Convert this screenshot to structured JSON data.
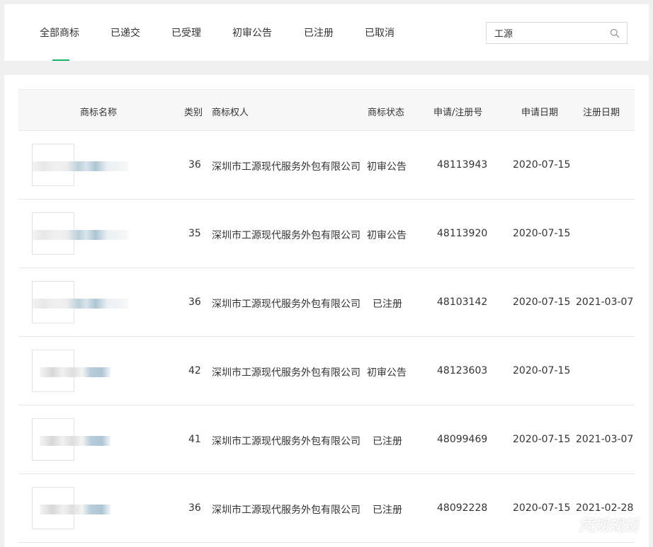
{
  "tabs": [
    {
      "label": "全部商标",
      "active": true
    },
    {
      "label": "已递交",
      "active": false
    },
    {
      "label": "已受理",
      "active": false
    },
    {
      "label": "初审公告",
      "active": false
    },
    {
      "label": "已注册",
      "active": false
    },
    {
      "label": "已取消",
      "active": false
    }
  ],
  "search": {
    "value": "工源",
    "icon": "search-icon"
  },
  "colors": {
    "accent": "#17b26a"
  },
  "table": {
    "headers": {
      "name": "商标名称",
      "category": "类别",
      "owner": "商标权人",
      "status": "商标状态",
      "number": "申请/注册号",
      "apply_date": "申请日期",
      "reg_date": "注册日期"
    },
    "rows": [
      {
        "category": "36",
        "owner": "深圳市工源现代服务外包有限公司",
        "status": "初审公告",
        "number": "48113943",
        "apply_date": "2020-07-15",
        "reg_date": ""
      },
      {
        "category": "35",
        "owner": "深圳市工源现代服务外包有限公司",
        "status": "初审公告",
        "number": "48113920",
        "apply_date": "2020-07-15",
        "reg_date": ""
      },
      {
        "category": "36",
        "owner": "深圳市工源现代服务外包有限公司",
        "status": "已注册",
        "number": "48103142",
        "apply_date": "2020-07-15",
        "reg_date": "2021-03-07"
      },
      {
        "category": "42",
        "owner": "深圳市工源现代服务外包有限公司",
        "status": "初审公告",
        "number": "48123603",
        "apply_date": "2020-07-15",
        "reg_date": ""
      },
      {
        "category": "41",
        "owner": "深圳市工源现代服务外包有限公司",
        "status": "已注册",
        "number": "48099469",
        "apply_date": "2020-07-15",
        "reg_date": "2021-03-07"
      },
      {
        "category": "36",
        "owner": "深圳市工源现代服务外包有限公司",
        "status": "已注册",
        "number": "48092228",
        "apply_date": "2020-07-15",
        "reg_date": "2021-02-28"
      }
    ]
  },
  "watermark": "凭规规规"
}
